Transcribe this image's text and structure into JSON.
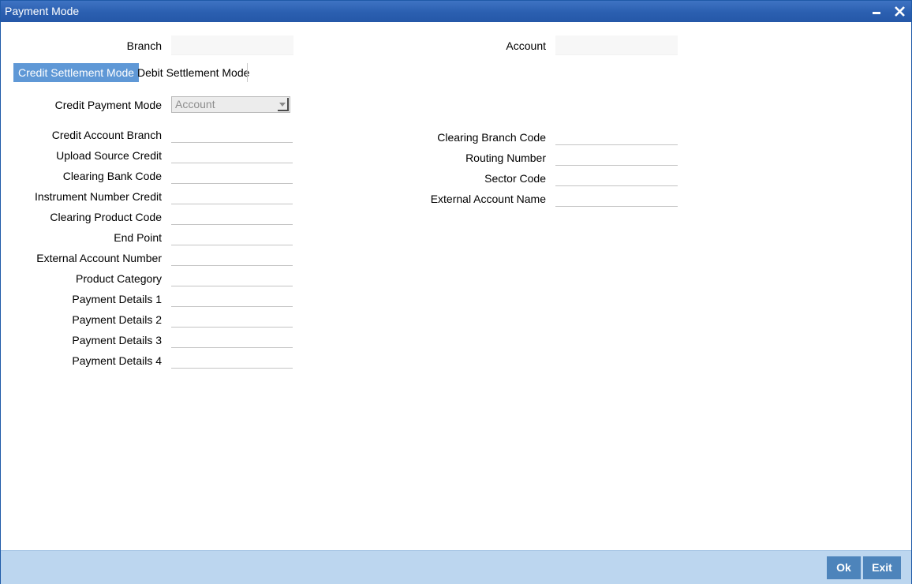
{
  "window": {
    "title": "Payment Mode"
  },
  "header": {
    "branch_label": "Branch",
    "branch_value": "",
    "account_label": "Account",
    "account_value": ""
  },
  "tabs": [
    {
      "label": "Credit Settlement Mode",
      "active": true
    },
    {
      "label": "Debit Settlement Mode",
      "active": false
    }
  ],
  "credit": {
    "payment_mode_label": "Credit Payment Mode",
    "payment_mode_value": "Account",
    "left_fields": [
      {
        "label": "Credit Account Branch",
        "value": ""
      },
      {
        "label": "Upload Source Credit",
        "value": ""
      },
      {
        "label": "Clearing Bank Code",
        "value": ""
      },
      {
        "label": "Instrument Number Credit",
        "value": ""
      },
      {
        "label": "Clearing Product Code",
        "value": ""
      },
      {
        "label": "End Point",
        "value": ""
      },
      {
        "label": "External Account Number",
        "value": ""
      },
      {
        "label": "Product Category",
        "value": ""
      },
      {
        "label": "Payment Details 1",
        "value": ""
      },
      {
        "label": "Payment Details 2",
        "value": ""
      },
      {
        "label": "Payment Details 3",
        "value": ""
      },
      {
        "label": "Payment Details 4",
        "value": ""
      }
    ],
    "right_fields": [
      {
        "label": "Clearing Branch Code",
        "value": ""
      },
      {
        "label": "Routing Number",
        "value": ""
      },
      {
        "label": "Sector Code",
        "value": ""
      },
      {
        "label": "External Account Name",
        "value": ""
      }
    ]
  },
  "footer": {
    "ok_label": "Ok",
    "exit_label": "Exit"
  },
  "colors": {
    "titlebar": "#2b5fb0",
    "active_tab": "#5f98d6",
    "footer_bg": "#bcd6ef",
    "footer_button": "#4d84bb"
  }
}
